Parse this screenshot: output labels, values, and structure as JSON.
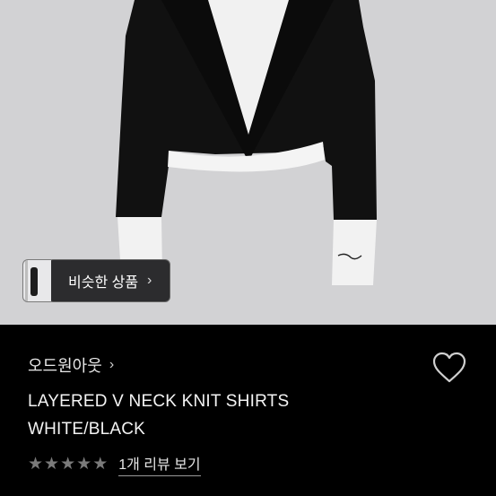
{
  "hero": {
    "image_icon": "knit-shirt-photo",
    "similar_button_label": "비슷한 상품",
    "similar_chevron": "›"
  },
  "product": {
    "brand": "오드원아웃",
    "brand_chevron": "›",
    "title": "LAYERED V NECK KNIT SHIRTS\nWHITE/BLACK",
    "rating_stars": 5,
    "star_color": "#7a7a7a",
    "review_link": "1개 리뷰 보기",
    "wishlist_icon": "heart-outline-icon"
  },
  "colors": {
    "hero_bg": "#d2d2d4",
    "info_bg": "#000000"
  }
}
